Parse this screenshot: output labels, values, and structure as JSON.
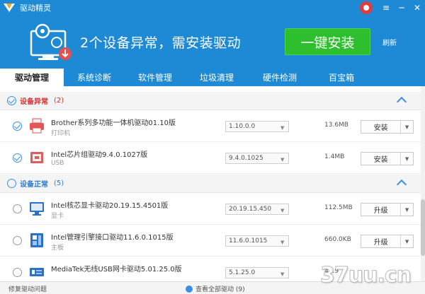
{
  "app": {
    "title": "驱动精灵"
  },
  "window_controls": {
    "menu": "≡",
    "minimize": "─",
    "close": "✕"
  },
  "header": {
    "message": "2个设备异常，需安装驱动",
    "install_button": "一键安装",
    "refresh": "刷新"
  },
  "tabs": [
    {
      "label": "驱动管理",
      "active": true
    },
    {
      "label": "系统诊断",
      "active": false
    },
    {
      "label": "软件管理",
      "active": false
    },
    {
      "label": "垃圾清理",
      "active": false
    },
    {
      "label": "硬件检测",
      "active": false
    },
    {
      "label": "百宝箱",
      "active": false
    }
  ],
  "groups": [
    {
      "title": "设备异常",
      "count": "(2)"
    },
    {
      "title": "设备正常",
      "count": "(5)"
    }
  ],
  "devices": [
    {
      "name": "Brother系列多功能一体机驱动01.10版",
      "type": "打印机",
      "version": "1.10.0.0",
      "size": "13.6MB",
      "action": "安装",
      "checked": true,
      "icon": "printer-icon"
    },
    {
      "name": "Intel芯片组驱动9.4.0.1027版",
      "type": "USB",
      "version": "9.4.0.1025",
      "size": "1.4MB",
      "action": "安装",
      "checked": true,
      "icon": "usb-chip-icon"
    },
    {
      "name": "Intel核芯显卡驱动20.19.15.4501版",
      "type": "显卡",
      "version": "20.19.15.450",
      "size": "112.5MB",
      "action": "升级",
      "checked": false,
      "icon": "monitor-icon"
    },
    {
      "name": "Intel管理引擎接口驱动11.6.0.1015版",
      "type": "主板",
      "version": "11.6.0.1015",
      "size": "660.0KB",
      "action": "升级",
      "checked": false,
      "icon": "mainboard-icon"
    },
    {
      "name": "MediaTek无线USB网卡驱动5.01.25.0版",
      "type": "",
      "version": "5.1.25.0",
      "size": "42.9",
      "action": "",
      "checked": false,
      "icon": "network-card-icon"
    }
  ],
  "footer": {
    "left": "修复驱动问题",
    "center": "查看全部驱动 (9)"
  },
  "watermark": "37uu.cn",
  "colors": {
    "primary": "#1e8ad6",
    "install_green": "#2dbf2d",
    "alert_red": "#d43030"
  }
}
